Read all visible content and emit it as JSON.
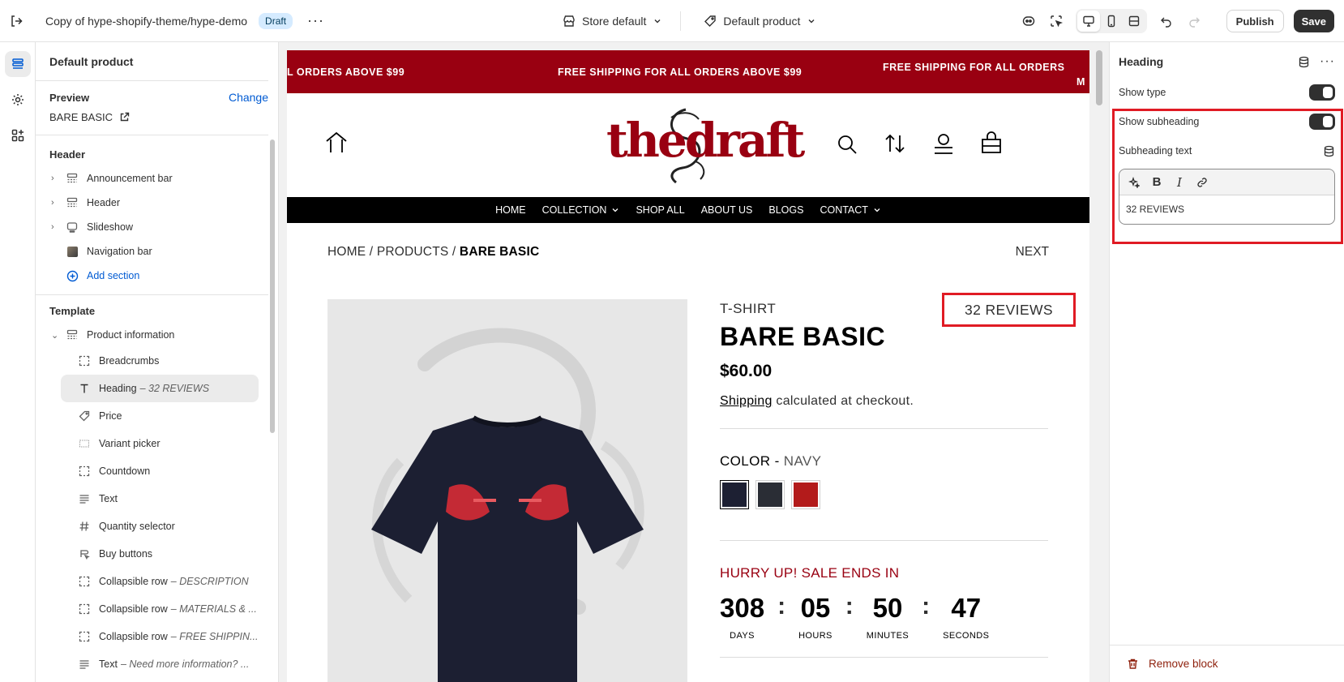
{
  "topbar": {
    "theme_title": "Copy of hype-shopify-theme/hype-demo",
    "status_badge": "Draft",
    "more": "···",
    "store_select": "Store default",
    "template_select": "Default product",
    "publish_label": "Publish",
    "save_label": "Save"
  },
  "sidebar": {
    "title": "Default product",
    "preview_label": "Preview",
    "change_label": "Change",
    "preview_value": "BARE BASIC",
    "header_section_title": "Header",
    "header_items": [
      {
        "label": "Announcement bar",
        "icon": "section-icon"
      },
      {
        "label": "Header",
        "icon": "section-icon"
      },
      {
        "label": "Slideshow",
        "icon": "slideshow-icon"
      },
      {
        "label": "Navigation bar",
        "icon": "image-thumb-icon"
      }
    ],
    "add_section": "Add section",
    "template_section_title": "Template",
    "template_parent": "Product information",
    "blocks": [
      {
        "label": "Breadcrumbs",
        "detail": "",
        "icon": "block-icon"
      },
      {
        "label": "Heading",
        "detail": "– 32 REVIEWS",
        "icon": "text-icon"
      },
      {
        "label": "Price",
        "detail": "",
        "icon": "price-tag-icon"
      },
      {
        "label": "Variant picker",
        "detail": "",
        "icon": "variant-icon"
      },
      {
        "label": "Countdown",
        "detail": "",
        "icon": "block-icon"
      },
      {
        "label": "Text",
        "detail": "",
        "icon": "text-lines-icon"
      },
      {
        "label": "Quantity selector",
        "detail": "",
        "icon": "hash-icon"
      },
      {
        "label": "Buy buttons",
        "detail": "",
        "icon": "buy-icon"
      },
      {
        "label": "Collapsible row",
        "detail": "– DESCRIPTION",
        "icon": "block-icon"
      },
      {
        "label": "Collapsible row",
        "detail": "– MATERIALS & ...",
        "icon": "block-icon"
      },
      {
        "label": "Collapsible row",
        "detail": "– FREE SHIPPIN...",
        "icon": "block-icon"
      },
      {
        "label": "Text",
        "detail": "– Need more information? ...",
        "icon": "text-lines-icon"
      }
    ]
  },
  "store": {
    "announcement": [
      "L ORDERS ABOVE $99",
      "FREE SHIPPING FOR ALL ORDERS ABOVE $99",
      "FREE SHIPPING FOR ALL ORDERS",
      "M"
    ],
    "logo": "thedraft",
    "nav": [
      "HOME",
      "COLLECTION",
      "SHOP ALL",
      "ABOUT US",
      "BLOGS",
      "CONTACT"
    ],
    "breadcrumb_prefix": "HOME / PRODUCTS / ",
    "breadcrumb_current": "BARE BASIC",
    "next_label": "NEXT",
    "product_type": "T-SHIRT",
    "reviews": "32 REVIEWS",
    "product_title": "BARE BASIC",
    "price": "$60.00",
    "shipping_link": "Shipping",
    "shipping_text": " calculated at checkout.",
    "color_label": "COLOR - ",
    "color_value": "NAVY",
    "swatch_colors": [
      "#1d2033",
      "#2a2d35",
      "#b31b1b"
    ],
    "hurry": "HURRY UP! SALE ENDS IN",
    "countdown": [
      {
        "value": "308",
        "label": "DAYS"
      },
      {
        "value": "05",
        "label": "HOURS"
      },
      {
        "value": "50",
        "label": "MINUTES"
      },
      {
        "value": "47",
        "label": "SECONDS"
      }
    ]
  },
  "settings": {
    "title": "Heading",
    "show_type_label": "Show type",
    "show_subheading_label": "Show subheading",
    "subheading_text_label": "Subheading text",
    "subheading_value": "32 REVIEWS",
    "remove_label": "Remove block"
  },
  "colors": {
    "accent_red": "#990011",
    "highlight_red": "#e01b24",
    "link_blue": "#005bd3",
    "primary_dark": "#303030"
  }
}
